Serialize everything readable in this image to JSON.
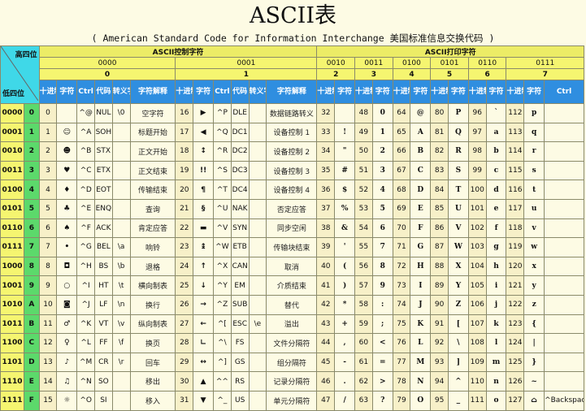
{
  "title": "ASCII表",
  "subtitle": "( American Standard Code for Information Interchange  美国标准信息交换代码 )",
  "header": {
    "high_label": "高四位",
    "low_label": "低四位",
    "ctrl_group": "ASCII控制字符",
    "print_group": "ASCII打印字符",
    "bin_cols": [
      "0000",
      "0001",
      "0010",
      "0011",
      "0100",
      "0101",
      "0110",
      "0111"
    ],
    "hex_cols": [
      "0",
      "1",
      "2",
      "3",
      "4",
      "5",
      "6",
      "7"
    ],
    "ctrl_sub": [
      "十进制",
      "字符",
      "Ctrl",
      "代码",
      "转义字符",
      "字符解释"
    ],
    "print_sub": [
      "十进制",
      "字符"
    ],
    "last_ctrl": "Ctrl"
  },
  "rows": [
    {
      "bin": "0000",
      "hex": "0",
      "c0": [
        "0",
        "",
        "^@",
        "NUL",
        "\\0",
        "空字符"
      ],
      "c1": [
        "16",
        "▶",
        "^P",
        "DLE",
        "",
        "数据链路转义"
      ],
      "p": [
        [
          "32",
          ""
        ],
        [
          "48",
          "0"
        ],
        [
          "64",
          "@"
        ],
        [
          "80",
          "P"
        ],
        [
          "96",
          "`"
        ],
        [
          "112",
          "p"
        ]
      ]
    },
    {
      "bin": "0001",
      "hex": "1",
      "c0": [
        "1",
        "☺",
        "^A",
        "SOH",
        "",
        "标题开始"
      ],
      "c1": [
        "17",
        "◀",
        "^Q",
        "DC1",
        "",
        "设备控制 1"
      ],
      "p": [
        [
          "33",
          "!"
        ],
        [
          "49",
          "1"
        ],
        [
          "65",
          "A"
        ],
        [
          "81",
          "Q"
        ],
        [
          "97",
          "a"
        ],
        [
          "113",
          "q"
        ]
      ]
    },
    {
      "bin": "0010",
      "hex": "2",
      "c0": [
        "2",
        "☻",
        "^B",
        "STX",
        "",
        "正文开始"
      ],
      "c1": [
        "18",
        "↕",
        "^R",
        "DC2",
        "",
        "设备控制 2"
      ],
      "p": [
        [
          "34",
          "\""
        ],
        [
          "50",
          "2"
        ],
        [
          "66",
          "B"
        ],
        [
          "82",
          "R"
        ],
        [
          "98",
          "b"
        ],
        [
          "114",
          "r"
        ]
      ]
    },
    {
      "bin": "0011",
      "hex": "3",
      "c0": [
        "3",
        "♥",
        "^C",
        "ETX",
        "",
        "正文结束"
      ],
      "c1": [
        "19",
        "!!",
        "^S",
        "DC3",
        "",
        "设备控制 3"
      ],
      "p": [
        [
          "35",
          "#"
        ],
        [
          "51",
          "3"
        ],
        [
          "67",
          "C"
        ],
        [
          "83",
          "S"
        ],
        [
          "99",
          "c"
        ],
        [
          "115",
          "s"
        ]
      ]
    },
    {
      "bin": "0100",
      "hex": "4",
      "c0": [
        "4",
        "♦",
        "^D",
        "EOT",
        "",
        "传输结束"
      ],
      "c1": [
        "20",
        "¶",
        "^T",
        "DC4",
        "",
        "设备控制 4"
      ],
      "p": [
        [
          "36",
          "$"
        ],
        [
          "52",
          "4"
        ],
        [
          "68",
          "D"
        ],
        [
          "84",
          "T"
        ],
        [
          "100",
          "d"
        ],
        [
          "116",
          "t"
        ]
      ]
    },
    {
      "bin": "0101",
      "hex": "5",
      "c0": [
        "5",
        "♣",
        "^E",
        "ENQ",
        "",
        "查询"
      ],
      "c1": [
        "21",
        "§",
        "^U",
        "NAK",
        "",
        "否定应答"
      ],
      "p": [
        [
          "37",
          "%"
        ],
        [
          "53",
          "5"
        ],
        [
          "69",
          "E"
        ],
        [
          "85",
          "U"
        ],
        [
          "101",
          "e"
        ],
        [
          "117",
          "u"
        ]
      ]
    },
    {
      "bin": "0110",
      "hex": "6",
      "c0": [
        "6",
        "♠",
        "^F",
        "ACK",
        "",
        "肯定应答"
      ],
      "c1": [
        "22",
        "▬",
        "^V",
        "SYN",
        "",
        "同步空闲"
      ],
      "p": [
        [
          "38",
          "&"
        ],
        [
          "54",
          "6"
        ],
        [
          "70",
          "F"
        ],
        [
          "86",
          "V"
        ],
        [
          "102",
          "f"
        ],
        [
          "118",
          "v"
        ]
      ]
    },
    {
      "bin": "0111",
      "hex": "7",
      "c0": [
        "7",
        "•",
        "^G",
        "BEL",
        "\\a",
        "响铃"
      ],
      "c1": [
        "23",
        "↨",
        "^W",
        "ETB",
        "",
        "传输块结束"
      ],
      "p": [
        [
          "39",
          "'"
        ],
        [
          "55",
          "7"
        ],
        [
          "71",
          "G"
        ],
        [
          "87",
          "W"
        ],
        [
          "103",
          "g"
        ],
        [
          "119",
          "w"
        ]
      ]
    },
    {
      "bin": "1000",
      "hex": "8",
      "c0": [
        "8",
        "◘",
        "^H",
        "BS",
        "\\b",
        "退格"
      ],
      "c1": [
        "24",
        "↑",
        "^X",
        "CAN",
        "",
        "取消"
      ],
      "p": [
        [
          "40",
          "("
        ],
        [
          "56",
          "8"
        ],
        [
          "72",
          "H"
        ],
        [
          "88",
          "X"
        ],
        [
          "104",
          "h"
        ],
        [
          "120",
          "x"
        ]
      ]
    },
    {
      "bin": "1001",
      "hex": "9",
      "c0": [
        "9",
        "○",
        "^I",
        "HT",
        "\\t",
        "横向制表"
      ],
      "c1": [
        "25",
        "↓",
        "^Y",
        "EM",
        "",
        "介质结束"
      ],
      "p": [
        [
          "41",
          ")"
        ],
        [
          "57",
          "9"
        ],
        [
          "73",
          "I"
        ],
        [
          "89",
          "Y"
        ],
        [
          "105",
          "i"
        ],
        [
          "121",
          "y"
        ]
      ]
    },
    {
      "bin": "1010",
      "hex": "A",
      "c0": [
        "10",
        "◙",
        "^J",
        "LF",
        "\\n",
        "换行"
      ],
      "c1": [
        "26",
        "→",
        "^Z",
        "SUB",
        "",
        "替代"
      ],
      "p": [
        [
          "42",
          "*"
        ],
        [
          "58",
          ":"
        ],
        [
          "74",
          "J"
        ],
        [
          "90",
          "Z"
        ],
        [
          "106",
          "j"
        ],
        [
          "122",
          "z"
        ]
      ]
    },
    {
      "bin": "1011",
      "hex": "B",
      "c0": [
        "11",
        "♂",
        "^K",
        "VT",
        "\\v",
        "纵向制表"
      ],
      "c1": [
        "27",
        "←",
        "^[",
        "ESC",
        "\\e",
        "溢出"
      ],
      "p": [
        [
          "43",
          "+"
        ],
        [
          "59",
          ";"
        ],
        [
          "75",
          "K"
        ],
        [
          "91",
          "["
        ],
        [
          "107",
          "k"
        ],
        [
          "123",
          "{"
        ]
      ]
    },
    {
      "bin": "1100",
      "hex": "C",
      "c0": [
        "12",
        "♀",
        "^L",
        "FF",
        "\\f",
        "换页"
      ],
      "c1": [
        "28",
        "∟",
        "^\\",
        "FS",
        "",
        "文件分隔符"
      ],
      "p": [
        [
          "44",
          ","
        ],
        [
          "60",
          "<"
        ],
        [
          "76",
          "L"
        ],
        [
          "92",
          "\\"
        ],
        [
          "108",
          "l"
        ],
        [
          "124",
          "|"
        ]
      ]
    },
    {
      "bin": "1101",
      "hex": "D",
      "c0": [
        "13",
        "♪",
        "^M",
        "CR",
        "\\r",
        "回车"
      ],
      "c1": [
        "29",
        "↔",
        "^]",
        "GS",
        "",
        "组分隔符"
      ],
      "p": [
        [
          "45",
          "-"
        ],
        [
          "61",
          "="
        ],
        [
          "77",
          "M"
        ],
        [
          "93",
          "]"
        ],
        [
          "109",
          "m"
        ],
        [
          "125",
          "}"
        ]
      ]
    },
    {
      "bin": "1110",
      "hex": "E",
      "c0": [
        "14",
        "♫",
        "^N",
        "SO",
        "",
        "移出"
      ],
      "c1": [
        "30",
        "▲",
        "^^",
        "RS",
        "",
        "记录分隔符"
      ],
      "p": [
        [
          "46",
          "."
        ],
        [
          "62",
          ">"
        ],
        [
          "78",
          "N"
        ],
        [
          "94",
          "^"
        ],
        [
          "110",
          "n"
        ],
        [
          "126",
          "~"
        ]
      ]
    },
    {
      "bin": "1111",
      "hex": "F",
      "c0": [
        "15",
        "☼",
        "^O",
        "SI",
        "",
        "移入"
      ],
      "c1": [
        "31",
        "▼",
        "^_",
        "US",
        "",
        "单元分隔符"
      ],
      "p": [
        [
          "47",
          "/"
        ],
        [
          "63",
          "?"
        ],
        [
          "79",
          "O"
        ],
        [
          "95",
          "_"
        ],
        [
          "111",
          "o"
        ],
        [
          "127",
          "⌂"
        ]
      ]
    }
  ],
  "last_ctrl_cell": "^Backspace 代码：DEL"
}
